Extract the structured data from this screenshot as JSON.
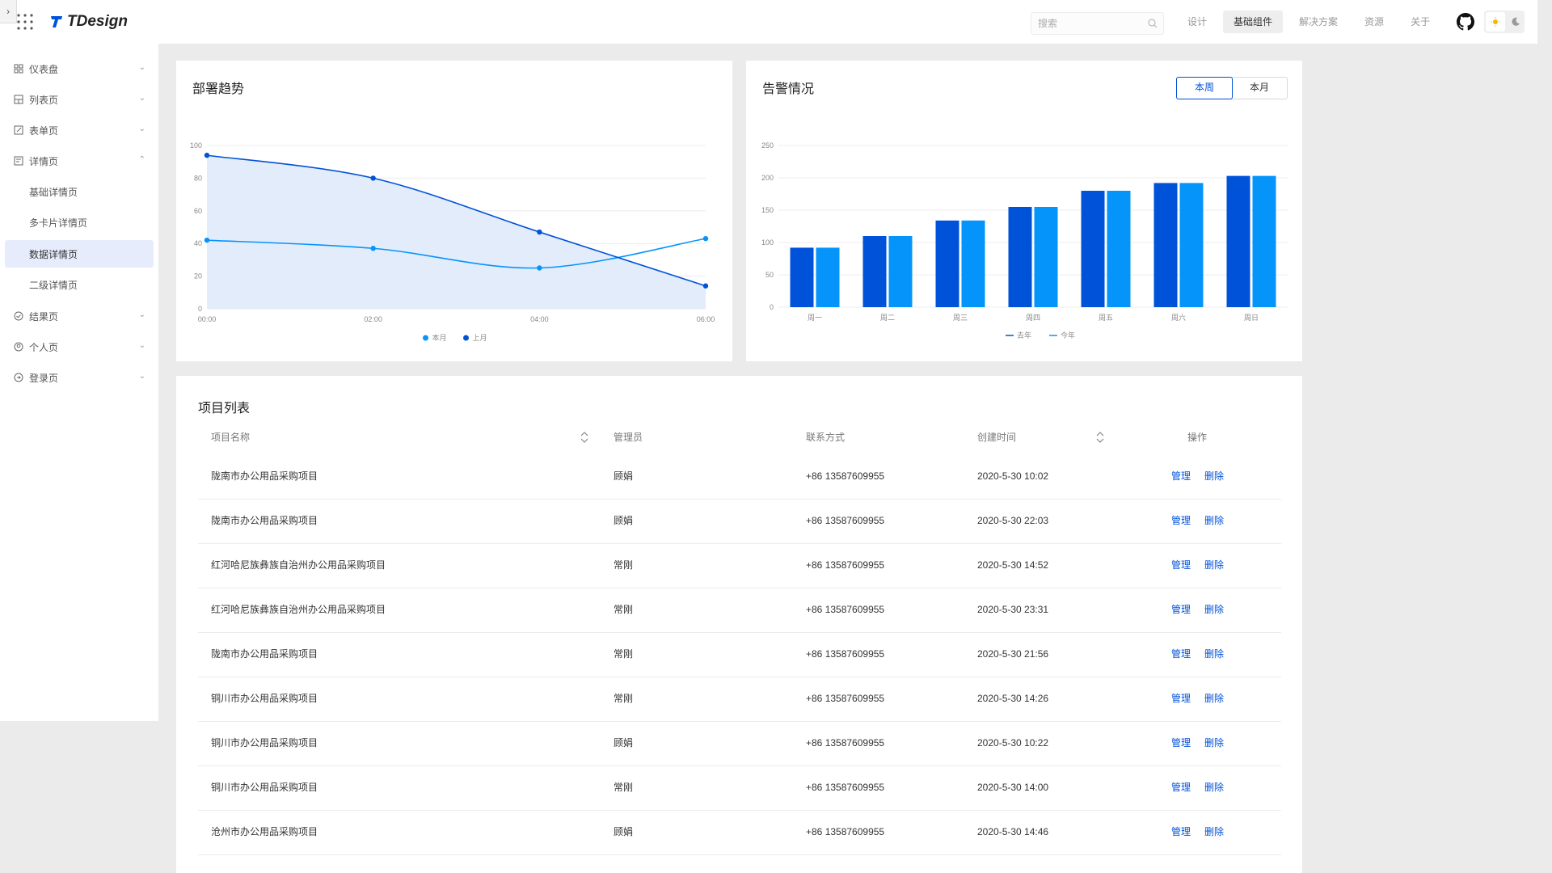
{
  "header": {
    "collapse_glyph": "›",
    "logo_text": "TDesign",
    "search_placeholder": "搜索",
    "nav": [
      "设计",
      "基础组件",
      "解决方案",
      "资源",
      "关于"
    ],
    "nav_active": "基础组件",
    "icons": [
      "grid-icon",
      "search-icon",
      "github-icon",
      "sun-icon",
      "moon-icon"
    ]
  },
  "sidebar": {
    "items": [
      {
        "label": "仪表盘",
        "icon": "dashboard-icon",
        "arrow": "⌄"
      },
      {
        "label": "列表页",
        "icon": "list-icon",
        "arrow": "⌄"
      },
      {
        "label": "表单页",
        "icon": "edit-icon",
        "arrow": "⌄"
      },
      {
        "label": "详情页",
        "icon": "detail-icon",
        "arrow": "⌃"
      },
      {
        "label": "基础详情页"
      },
      {
        "label": "多卡片详情页"
      },
      {
        "label": "数据详情页",
        "selected": true
      },
      {
        "label": "二级详情页"
      },
      {
        "label": "结果页",
        "icon": "check-circle-icon",
        "arrow": "⌄"
      },
      {
        "label": "个人页",
        "icon": "user-circle-icon",
        "arrow": "⌄"
      },
      {
        "label": "登录页",
        "icon": "login-icon",
        "arrow": "⌄"
      }
    ]
  },
  "trend_card": {
    "title": "部署趋势",
    "chart_data": {
      "type": "line",
      "x": [
        "00:00",
        "02:00",
        "04:00",
        "06:00"
      ],
      "ylim": [
        0,
        100
      ],
      "yticks": [
        "0",
        "20",
        "40",
        "60",
        "80",
        "100"
      ],
      "legend": "bottom",
      "series": [
        {
          "name": "本月",
          "color": "#0594fa",
          "values": [
            42,
            37,
            25,
            43
          ]
        },
        {
          "name": "上月",
          "color": "#0052d9",
          "values": [
            94,
            80,
            47,
            14
          ],
          "area": true
        }
      ]
    }
  },
  "alarm_card": {
    "title": "告警情况",
    "toggle": [
      "本周",
      "本月"
    ],
    "toggle_active": "本周",
    "chart_data": {
      "type": "bar",
      "categories": [
        "周一",
        "周二",
        "周三",
        "周四",
        "周五",
        "周六",
        "周日"
      ],
      "ylim": [
        0,
        250
      ],
      "yticks": [
        "0",
        "50",
        "100",
        "150",
        "200",
        "250"
      ],
      "legend": "bottom",
      "series": [
        {
          "name": "去年",
          "color": "#0052d9",
          "values": [
            92,
            110,
            134,
            155,
            180,
            192,
            203
          ]
        },
        {
          "name": "今年",
          "color": "#0594fa",
          "values": [
            92,
            110,
            134,
            155,
            180,
            192,
            203
          ]
        }
      ]
    }
  },
  "project_table": {
    "title": "项目列表",
    "columns": [
      "项目名称",
      "管理员",
      "联系方式",
      "创建时间",
      "操作"
    ],
    "actions": [
      "管理",
      "删除"
    ],
    "rows": [
      {
        "name": "陇南市办公用品采购项目",
        "admin": "顾娟",
        "phone": "+86 13587609955",
        "time": "2020-5-30 10:02"
      },
      {
        "name": "陇南市办公用品采购项目",
        "admin": "顾娟",
        "phone": "+86 13587609955",
        "time": "2020-5-30 22:03"
      },
      {
        "name": "红河哈尼族彝族自治州办公用品采购项目",
        "admin": "常刚",
        "phone": "+86 13587609955",
        "time": "2020-5-30 14:52"
      },
      {
        "name": "红河哈尼族彝族自治州办公用品采购项目",
        "admin": "常刚",
        "phone": "+86 13587609955",
        "time": "2020-5-30 23:31"
      },
      {
        "name": "陇南市办公用品采购项目",
        "admin": "常刚",
        "phone": "+86 13587609955",
        "time": "2020-5-30 21:56"
      },
      {
        "name": "铜川市办公用品采购项目",
        "admin": "常刚",
        "phone": "+86 13587609955",
        "time": "2020-5-30 14:26"
      },
      {
        "name": "铜川市办公用品采购项目",
        "admin": "顾娟",
        "phone": "+86 13587609955",
        "time": "2020-5-30 10:22"
      },
      {
        "name": "铜川市办公用品采购项目",
        "admin": "常刚",
        "phone": "+86 13587609955",
        "time": "2020-5-30 14:00"
      },
      {
        "name": "沧州市办公用品采购项目",
        "admin": "顾娟",
        "phone": "+86 13587609955",
        "time": "2020-5-30 14:46"
      }
    ]
  }
}
